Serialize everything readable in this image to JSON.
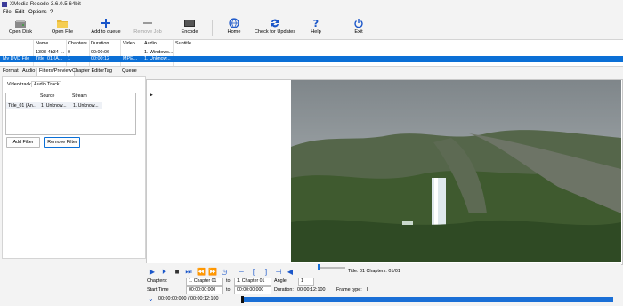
{
  "window": {
    "title": "XMedia Recode 3.6.0.5 64bit"
  },
  "menu": {
    "items": [
      "File",
      "Edit",
      "Options",
      "?"
    ]
  },
  "toolbar": {
    "open_disk": "Open Disk",
    "open_file": "Open File",
    "add_to_queue": "Add to queue",
    "remove_job": "Remove Job",
    "encode": "Encode",
    "home": "Home",
    "check_updates": "Check for Updates",
    "help": "Help",
    "exit": "Exit"
  },
  "file_table": {
    "headers": [
      "Name",
      "Chapters",
      "Duration",
      "Video",
      "Audio",
      "Subtitle"
    ],
    "rows": [
      [
        "",
        "1303-4b34-...",
        "0",
        "00:00:06",
        "",
        "1. Windows...",
        ""
      ],
      [
        "My DVD File",
        "Title_01 (A...",
        "1",
        "00:00:12",
        "MPE...",
        "1. Unknow...",
        ""
      ]
    ]
  },
  "tabs": [
    "Format",
    "Audio",
    "Filters/Preview",
    "Chapter Editor",
    "Tag",
    "Queue"
  ],
  "subtabs": [
    "Video track",
    "Audio Track"
  ],
  "stream_table": {
    "headers": [
      "Source",
      "Stream"
    ],
    "row": [
      "Title_01 (An...",
      "1. Unknow...",
      "1. Unknow..."
    ]
  },
  "buttons": {
    "add_filter": "Add Filter",
    "remove_filter": "Remove Filter"
  },
  "preview": {
    "play_arrow": "▶"
  },
  "playback": {
    "title_info": "Title: 01 Chapters: 01/01",
    "chapters_label": "Chapters:",
    "chapter_from": "1. Chapter 01",
    "to1": "to",
    "chapter_to": "1. Chapter 01",
    "angle_label": "Angle",
    "angle_value": "1",
    "start_time_label": "Start Time",
    "start_time": "00:00:00:000",
    "to2": "to",
    "end_time": "00:00:00:000",
    "duration_label": "Duration:",
    "duration_value": "00:00:12:100",
    "frame_type_label": "Frame type:",
    "frame_type_value": "I",
    "timecode": "00:00:00:000 / 00:00:12:100"
  },
  "colors": {
    "accent": "#1a56c9",
    "selection": "#0b6fd6"
  }
}
